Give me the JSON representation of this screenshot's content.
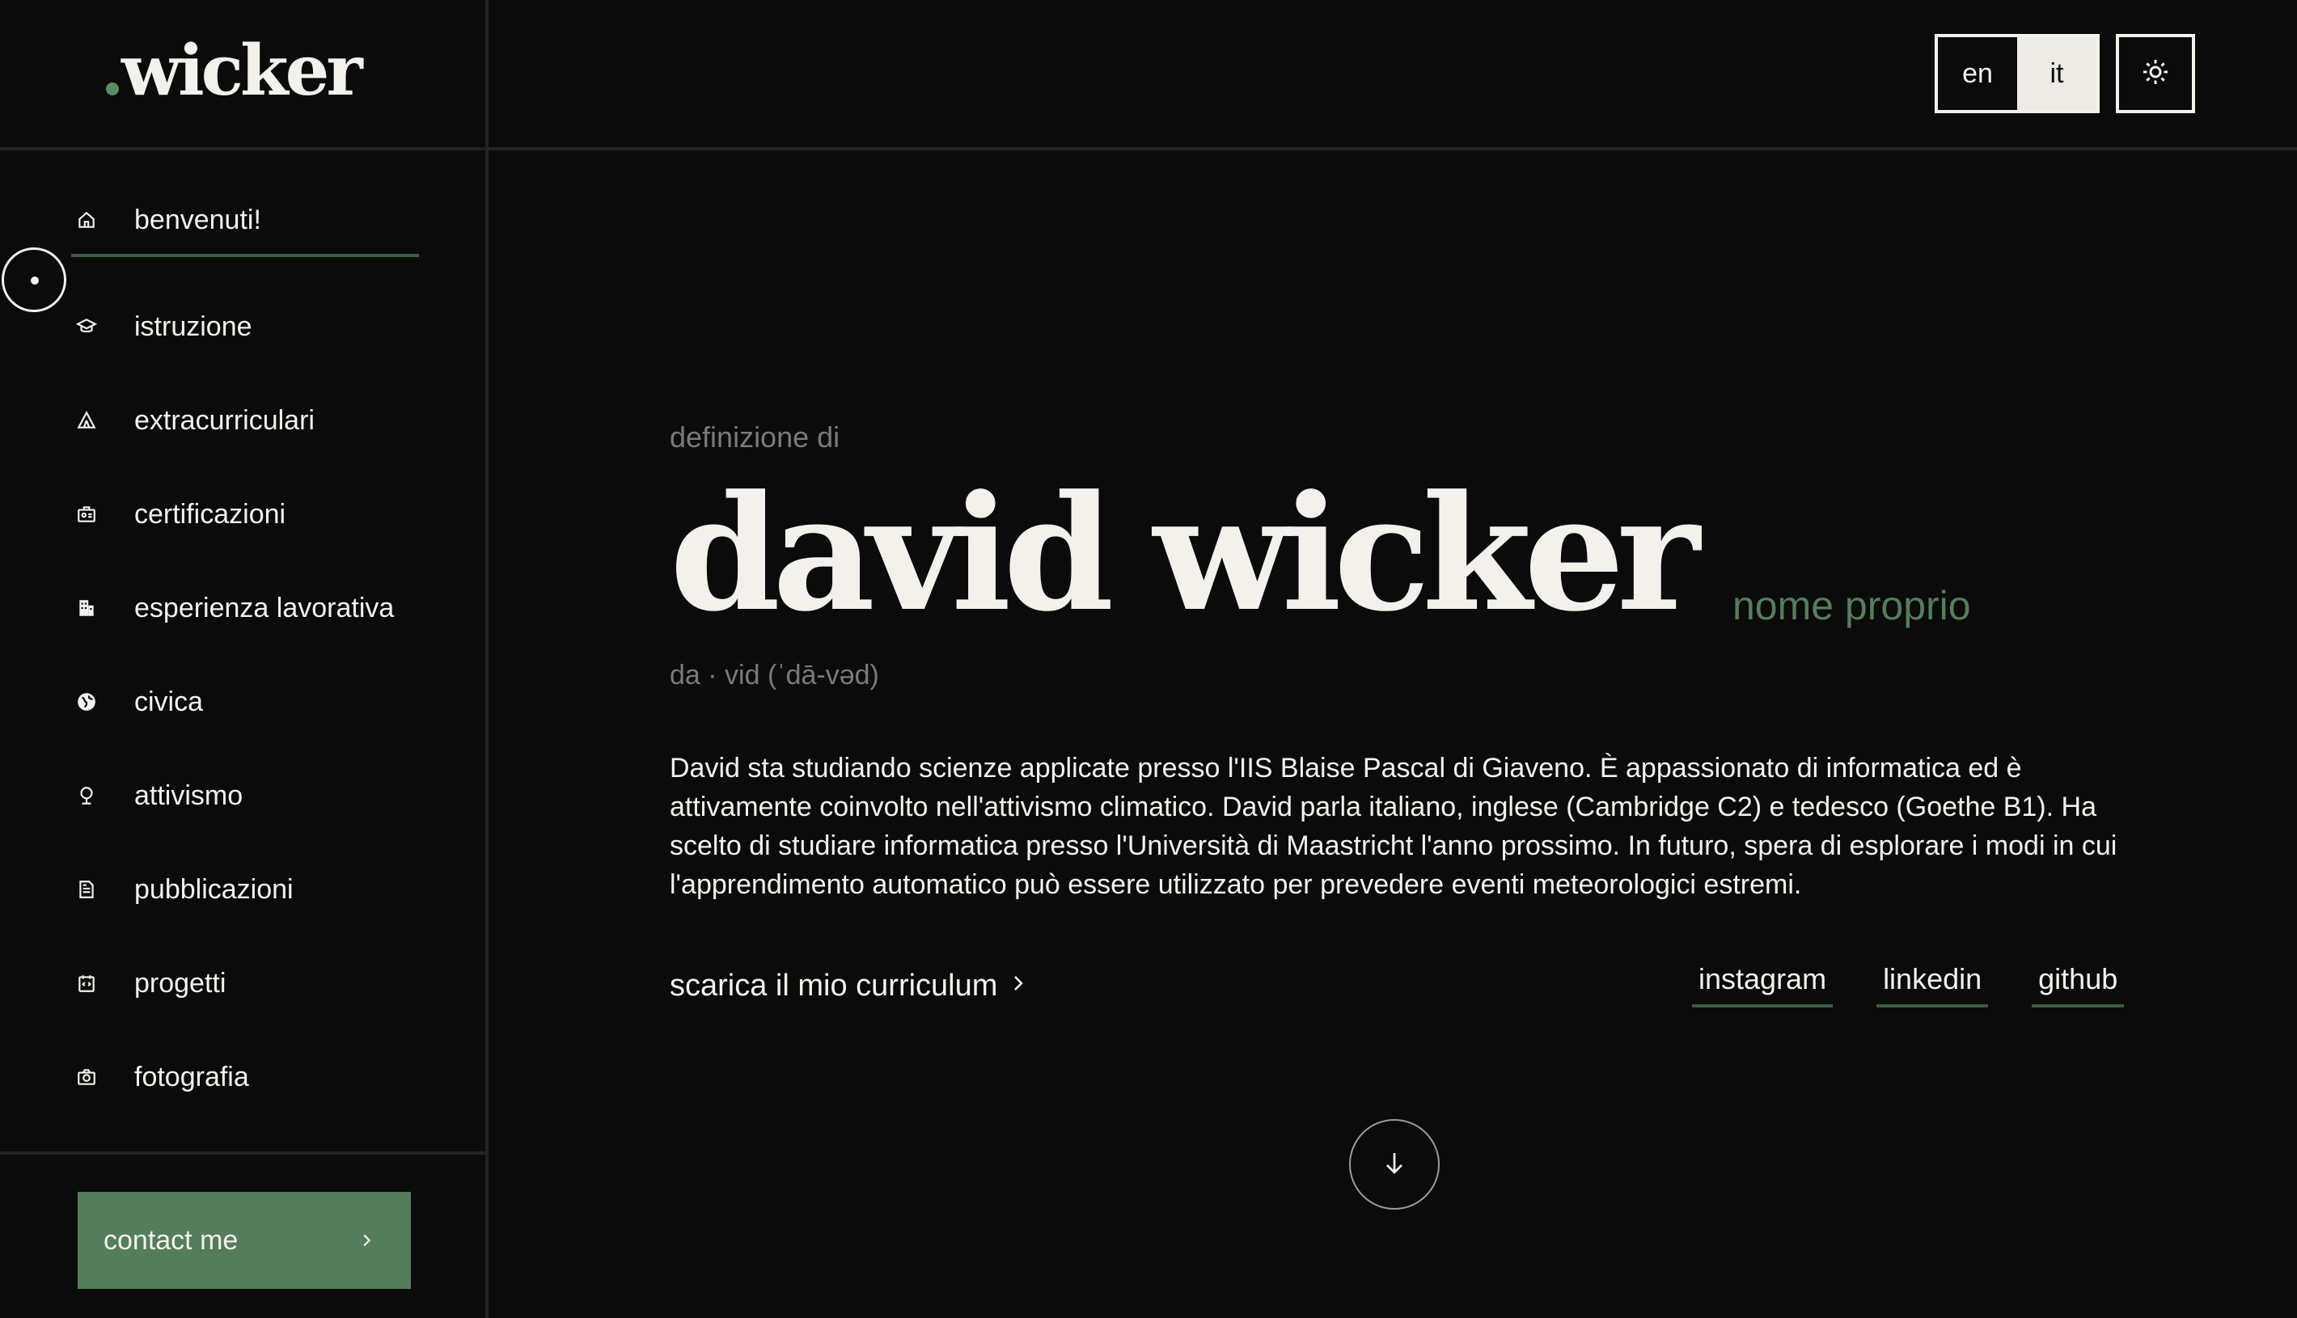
{
  "brand": {
    "dot": ".",
    "name": "wicker"
  },
  "sidebar": {
    "items": [
      {
        "label": "benvenuti!",
        "icon": "home-icon"
      },
      {
        "label": "istruzione",
        "icon": "graduation-cap-icon"
      },
      {
        "label": "extracurriculari",
        "icon": "tent-icon"
      },
      {
        "label": "certificazioni",
        "icon": "certificate-icon"
      },
      {
        "label": "esperienza lavorativa",
        "icon": "building-icon"
      },
      {
        "label": "civica",
        "icon": "globe-icon"
      },
      {
        "label": "attivismo",
        "icon": "tree-icon"
      },
      {
        "label": "pubblicazioni",
        "icon": "document-icon"
      },
      {
        "label": "progetti",
        "icon": "code-icon"
      },
      {
        "label": "fotografia",
        "icon": "camera-icon"
      }
    ],
    "active_index": 0,
    "contact_label": "contact me"
  },
  "topbar": {
    "lang_en": "en",
    "lang_it": "it",
    "selected_lang": "it",
    "theme_icon": "sun-icon"
  },
  "hero": {
    "definition_label": "definizione di",
    "name": "david wicker",
    "word_class": "nome proprio",
    "pronunciation": "da · vid (ˈdā-vəd)",
    "bio": "David sta studiando scienze applicate presso l'IIS Blaise Pascal di Giaveno. È appassionato di informatica ed è attivamente coinvolto nell'attivismo climatico. David parla italiano, inglese (Cambridge C2) e tedesco (Goethe B1). Ha scelto di studiare informatica presso l'Università di Maastricht l'anno prossimo. In futuro, spera di esplorare i modi in cui l'apprendimento automatico può essere utilizzato per prevedere eventi meteorologici estremi.",
    "cv_label": "scarica il mio curriculum",
    "socials": [
      "instagram",
      "linkedin",
      "github"
    ]
  },
  "colors": {
    "background": "#0b0b0b",
    "text": "#f2f1ec",
    "accent": "#557d5b",
    "muted": "#7a7a7a"
  }
}
